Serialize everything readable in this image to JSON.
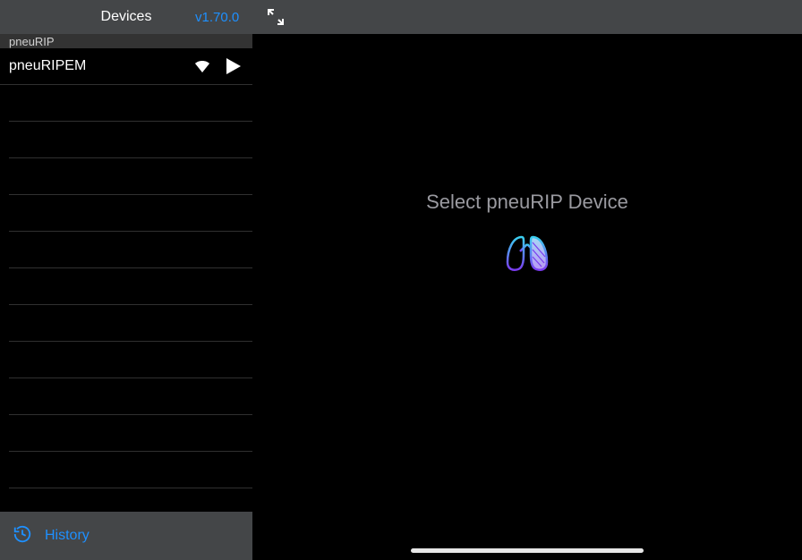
{
  "topbar": {
    "title": "Devices",
    "version": "v1.70.0"
  },
  "sidebar": {
    "header": "pneuRIP",
    "devices": [
      {
        "name": "pneuRIPEM"
      }
    ],
    "emptyRowCount": 12,
    "footer": {
      "label": "History"
    }
  },
  "content": {
    "prompt": "Select pneuRIP Device"
  },
  "colors": {
    "accent": "#1e90ff"
  }
}
